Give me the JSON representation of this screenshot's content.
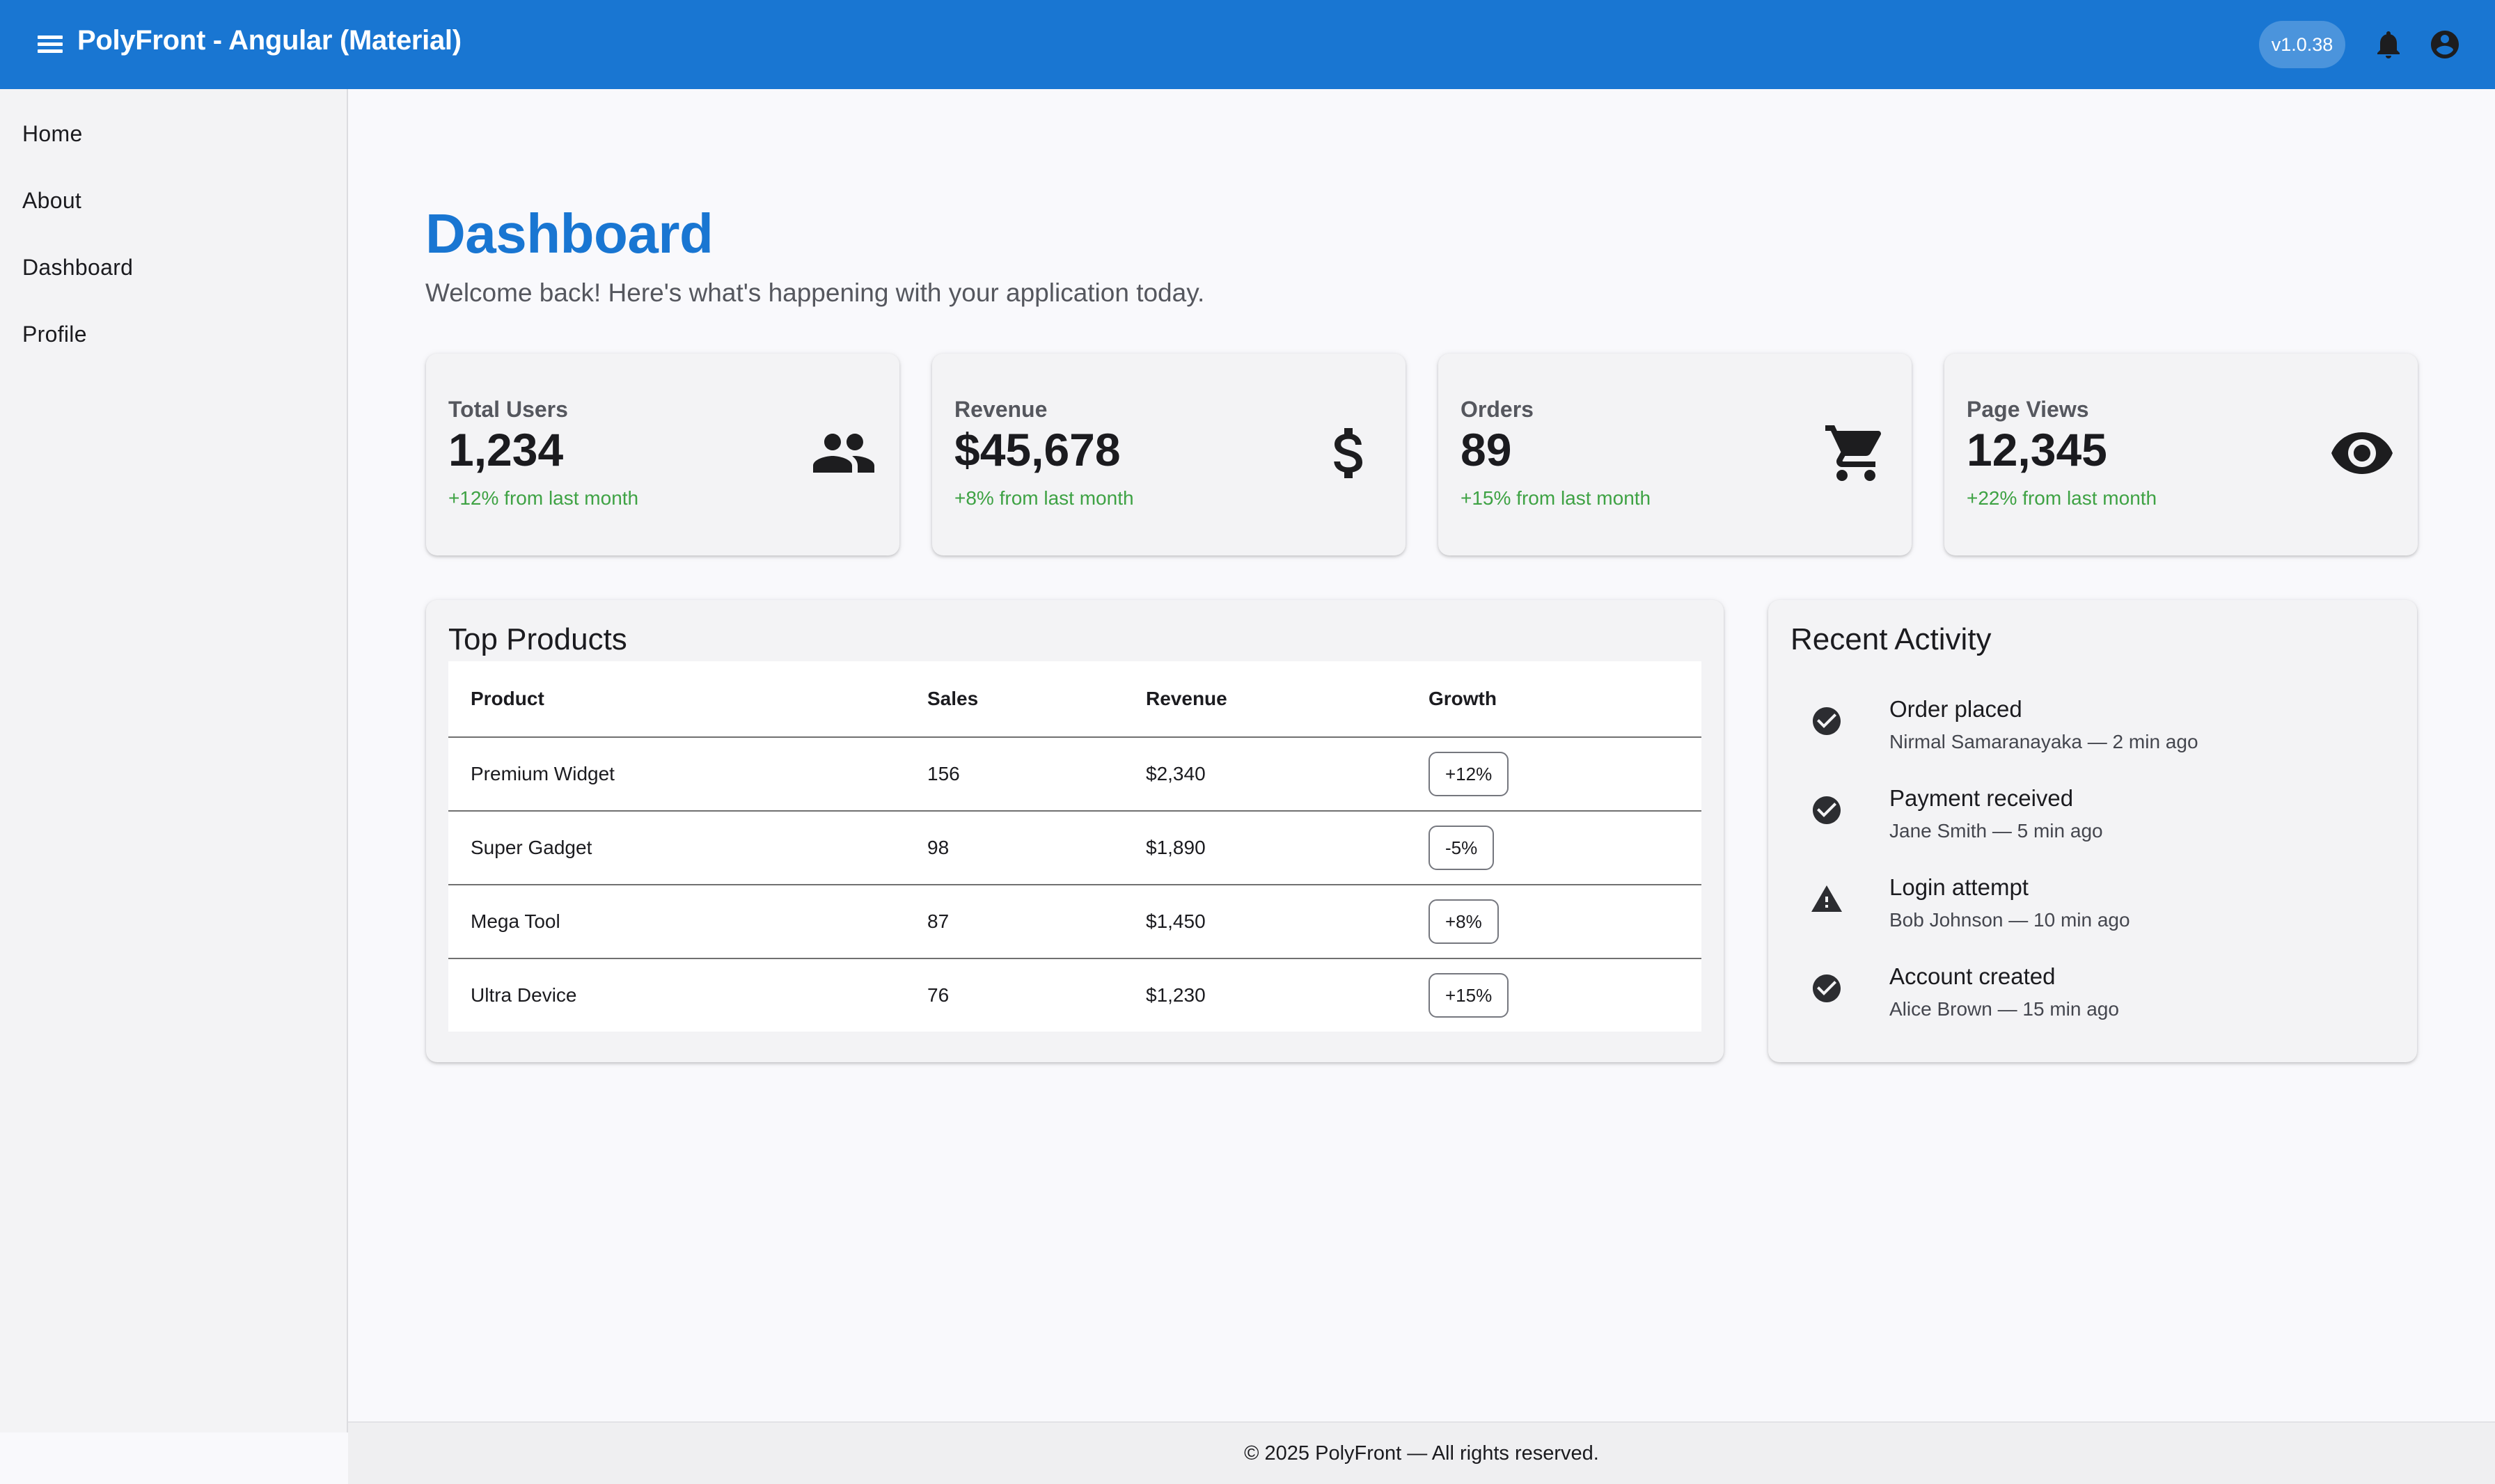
{
  "app": {
    "title": "PolyFront - Angular (Material)",
    "version": "v1.0.38",
    "brand_color": "#1976d2"
  },
  "toolbar": {
    "icons": [
      "menu-icon",
      "bell-icon",
      "account-circle-icon"
    ]
  },
  "sidebar": {
    "items": [
      {
        "label": "Home"
      },
      {
        "label": "About"
      },
      {
        "label": "Dashboard"
      },
      {
        "label": "Profile"
      }
    ]
  },
  "dashboard": {
    "title": "Dashboard",
    "subtitle": "Welcome back! Here's what's happening with your application today.",
    "stats": [
      {
        "label": "Total Users",
        "value": "1,234",
        "change": "+12% from last month",
        "icon": "people-icon"
      },
      {
        "label": "Revenue",
        "value": "$45,678",
        "change": "+8% from last month",
        "icon": "dollar-icon"
      },
      {
        "label": "Orders",
        "value": "89",
        "change": "+15% from last month",
        "icon": "cart-icon"
      },
      {
        "label": "Page Views",
        "value": "12,345",
        "change": "+22% from last month",
        "icon": "eye-icon"
      }
    ],
    "positive_color": "#3ea244"
  },
  "top_products": {
    "title": "Top Products",
    "columns": [
      "Product",
      "Sales",
      "Revenue",
      "Growth"
    ],
    "rows": [
      {
        "product": "Premium Widget",
        "sales": "156",
        "revenue": "$2,340",
        "growth": "+12%"
      },
      {
        "product": "Super Gadget",
        "sales": "98",
        "revenue": "$1,890",
        "growth": "-5%"
      },
      {
        "product": "Mega Tool",
        "sales": "87",
        "revenue": "$1,450",
        "growth": "+8%"
      },
      {
        "product": "Ultra Device",
        "sales": "76",
        "revenue": "$1,230",
        "growth": "+15%"
      }
    ]
  },
  "recent_activity": {
    "title": "Recent Activity",
    "items": [
      {
        "title": "Order placed",
        "meta": "Nirmal Samaranayaka — 2 min ago",
        "icon": "check-circle-icon"
      },
      {
        "title": "Payment received",
        "meta": "Jane Smith — 5 min ago",
        "icon": "check-circle-icon"
      },
      {
        "title": "Login attempt",
        "meta": "Bob Johnson — 10 min ago",
        "icon": "warning-icon"
      },
      {
        "title": "Account created",
        "meta": "Alice Brown — 15 min ago",
        "icon": "check-circle-icon"
      }
    ]
  },
  "footer": {
    "text": "© 2025 PolyFront — All rights reserved."
  }
}
